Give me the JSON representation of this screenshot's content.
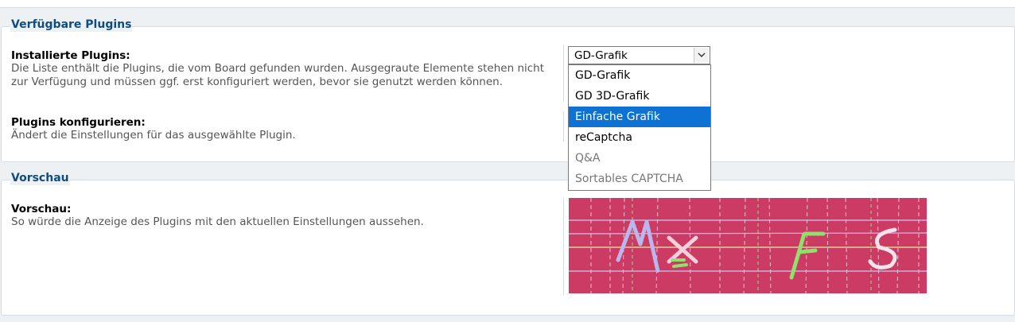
{
  "section1": {
    "legend": "Verfügbare Plugins",
    "installed_label": "Installierte Plugins:",
    "installed_desc": "Die Liste enthält die Plugins, die vom Board gefunden wurden. Ausgegraute Elemente stehen nicht zur Verfügung und müssen ggf. erst konfiguriert werden, bevor sie genutzt werden können.",
    "configure_label": "Plugins konfigurieren:",
    "configure_desc": "Ändert die Einstellungen für das ausgewählte Plugin."
  },
  "select": {
    "value": "GD-Grafik",
    "options": [
      {
        "label": "GD-Grafik",
        "state": "normal"
      },
      {
        "label": "GD 3D-Grafik",
        "state": "normal"
      },
      {
        "label": "Einfache Grafik",
        "state": "highlighted"
      },
      {
        "label": "reCaptcha",
        "state": "normal"
      },
      {
        "label": "Q&A",
        "state": "disabled"
      },
      {
        "label": "Sortables CAPTCHA",
        "state": "disabled"
      }
    ]
  },
  "section2": {
    "legend": "Vorschau",
    "preview_label": "Vorschau:",
    "preview_desc": "So würde die Anzeige des Plugins mit den aktuellen Einstellungen aussehen."
  },
  "colors": {
    "legend": "#0f4c81",
    "highlight": "#0d72d4",
    "captcha_bg": "#cc3b63"
  }
}
